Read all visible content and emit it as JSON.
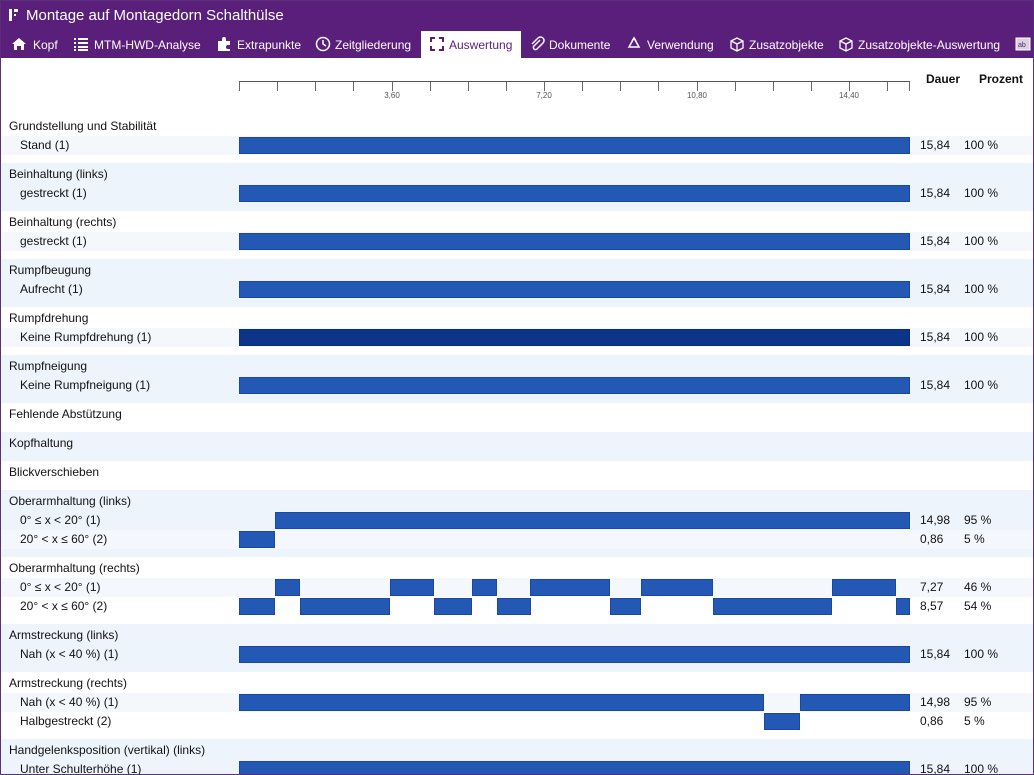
{
  "window": {
    "title": "Montage auf Montagedorn Schalthülse",
    "title_icon": "document-icon"
  },
  "tabs": [
    {
      "label": "Kopf",
      "icon": "home-icon",
      "active": false
    },
    {
      "label": "MTM-HWD-Analyse",
      "icon": "list-icon",
      "active": false
    },
    {
      "label": "Extrapunkte",
      "icon": "puzzle-icon",
      "active": false
    },
    {
      "label": "Zeitgliederung",
      "icon": "clock-icon",
      "active": false
    },
    {
      "label": "Auswertung",
      "icon": "dashed-frame-icon",
      "active": true
    },
    {
      "label": "Dokumente",
      "icon": "paperclip-icon",
      "active": false
    },
    {
      "label": "Verwendung",
      "icon": "recycle-icon",
      "active": false
    },
    {
      "label": "Zusatzobjekte",
      "icon": "box-icon",
      "active": false
    },
    {
      "label": "Zusatzobjekte-Auswertung",
      "icon": "box-icon",
      "active": false
    },
    {
      "label": "",
      "icon": "text-field-icon",
      "active": false
    }
  ],
  "columns": {
    "duration": "Dauer",
    "percent": "Prozent"
  },
  "axis": {
    "max": 15.84,
    "minor_ticks": [
      0,
      0.9,
      1.8,
      2.7,
      3.6,
      4.5,
      5.4,
      6.3,
      7.2,
      8.1,
      9.0,
      9.9,
      10.8,
      11.7,
      12.6,
      13.5,
      14.4,
      15.3
    ],
    "labels": [
      {
        "value": 3.6,
        "text": "3,60"
      },
      {
        "value": 7.2,
        "text": "7,20"
      },
      {
        "value": 10.8,
        "text": "10,80"
      },
      {
        "value": 14.4,
        "text": "14,40"
      }
    ]
  },
  "colors": {
    "bar": "#2458b5",
    "bar_dark": "#0c3489",
    "band": "#eef4fb",
    "brand": "#5a1f7b"
  },
  "groups": [
    {
      "title": "Grundstellung und Stabilität",
      "rows": [
        {
          "name": "Stand (1)",
          "duration": "15,84",
          "percent": "100 %",
          "segments": [
            [
              0,
              15.84
            ]
          ]
        }
      ]
    },
    {
      "title": "Beinhaltung (links)",
      "rows": [
        {
          "name": "gestreckt (1)",
          "duration": "15,84",
          "percent": "100 %",
          "segments": [
            [
              0,
              15.84
            ]
          ]
        }
      ]
    },
    {
      "title": "Beinhaltung (rechts)",
      "rows": [
        {
          "name": "gestreckt (1)",
          "duration": "15,84",
          "percent": "100 %",
          "segments": [
            [
              0,
              15.84
            ]
          ]
        }
      ]
    },
    {
      "title": "Rumpfbeugung",
      "rows": [
        {
          "name": "Aufrecht (1)",
          "duration": "15,84",
          "percent": "100 %",
          "segments": [
            [
              0,
              15.84
            ]
          ]
        }
      ]
    },
    {
      "title": "Rumpfdrehung",
      "rows": [
        {
          "name": "Keine Rumpfdrehung (1)",
          "duration": "15,84",
          "percent": "100 %",
          "segments": [
            [
              0,
              15.84
            ]
          ],
          "dark": true
        }
      ]
    },
    {
      "title": "Rumpfneigung",
      "rows": [
        {
          "name": "Keine Rumpfneigung (1)",
          "duration": "15,84",
          "percent": "100 %",
          "segments": [
            [
              0,
              15.84
            ]
          ]
        }
      ]
    },
    {
      "title": "Fehlende Abstützung",
      "rows": []
    },
    {
      "title": "Kopfhaltung",
      "rows": []
    },
    {
      "title": "Blickverschieben",
      "rows": []
    },
    {
      "title": "Oberarmhaltung (links)",
      "rows": [
        {
          "name": "0° ≤ x < 20° (1)",
          "duration": "14,98",
          "percent": "95 %",
          "segments": [
            [
              0.86,
              15.84
            ]
          ]
        },
        {
          "name": "20° < x ≤ 60° (2)",
          "duration": "0,86",
          "percent": "5 %",
          "segments": [
            [
              0,
              0.86
            ]
          ]
        }
      ]
    },
    {
      "title": "Oberarmhaltung (rechts)",
      "rows": [
        {
          "name": "0° ≤ x < 20° (1)",
          "duration": "7,27",
          "percent": "46 %",
          "segments": [
            [
              0.86,
              1.44
            ],
            [
              3.57,
              4.6
            ],
            [
              5.5,
              6.08
            ],
            [
              6.88,
              8.76
            ],
            [
              9.5,
              11.2
            ],
            [
              14.0,
              15.5
            ]
          ]
        },
        {
          "name": "20° < x ≤ 60° (2)",
          "duration": "8,57",
          "percent": "54 %",
          "segments": [
            [
              0,
              0.86
            ],
            [
              1.44,
              3.57
            ],
            [
              4.6,
              5.5
            ],
            [
              6.08,
              6.88
            ],
            [
              8.76,
              9.5
            ],
            [
              11.2,
              14.0
            ],
            [
              15.5,
              15.84
            ]
          ]
        }
      ]
    },
    {
      "title": "Armstreckung (links)",
      "rows": [
        {
          "name": "Nah (x < 40 %) (1)",
          "duration": "15,84",
          "percent": "100 %",
          "segments": [
            [
              0,
              15.84
            ]
          ]
        }
      ]
    },
    {
      "title": "Armstreckung (rechts)",
      "rows": [
        {
          "name": "Nah (x < 40 %) (1)",
          "duration": "14,98",
          "percent": "95 %",
          "segments": [
            [
              0,
              12.39
            ],
            [
              13.25,
              15.84
            ]
          ]
        },
        {
          "name": "Halbgestreckt (2)",
          "duration": "0,86",
          "percent": "5 %",
          "segments": [
            [
              12.39,
              13.25
            ]
          ]
        }
      ]
    },
    {
      "title": "Handgelenksposition (vertikal) (links)",
      "rows": [
        {
          "name": "Unter Schulterhöhe (1)",
          "duration": "15,84",
          "percent": "100 %",
          "segments": [
            [
              0,
              15.84
            ]
          ]
        }
      ]
    }
  ]
}
